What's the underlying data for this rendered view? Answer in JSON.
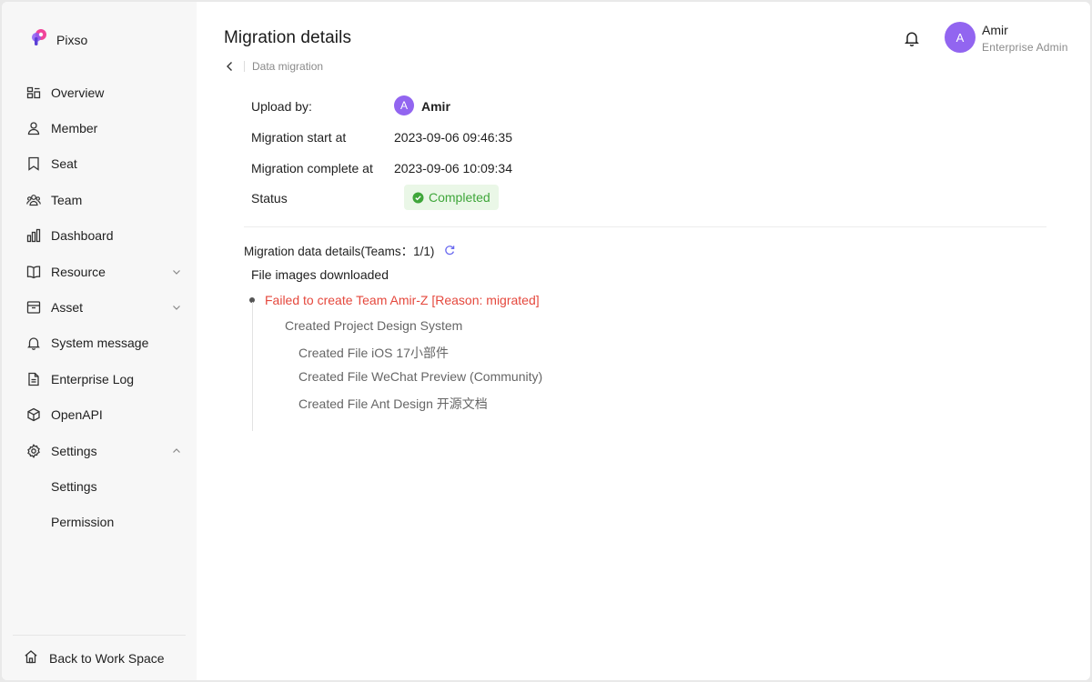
{
  "app": {
    "name": "Pixso"
  },
  "sidebar": {
    "items": [
      {
        "label": "Overview",
        "icon": "overview-icon"
      },
      {
        "label": "Member",
        "icon": "user-icon"
      },
      {
        "label": "Seat",
        "icon": "bookmark-icon"
      },
      {
        "label": "Team",
        "icon": "team-icon"
      },
      {
        "label": "Dashboard",
        "icon": "bar-chart-icon"
      },
      {
        "label": "Resource",
        "icon": "book-icon",
        "expandable": true,
        "expanded": false
      },
      {
        "label": "Asset",
        "icon": "archive-icon",
        "expandable": true,
        "expanded": false
      },
      {
        "label": "System message",
        "icon": "bell-icon"
      },
      {
        "label": "Enterprise Log",
        "icon": "file-icon"
      },
      {
        "label": "OpenAPI",
        "icon": "cube-icon"
      },
      {
        "label": "Settings",
        "icon": "gear-icon",
        "expandable": true,
        "expanded": true
      }
    ],
    "subitems": [
      {
        "label": "Settings"
      },
      {
        "label": "Permission"
      }
    ],
    "back_label": "Back to Work Space"
  },
  "header": {
    "title": "Migration details",
    "breadcrumb": "Data migration",
    "user": {
      "initial": "A",
      "name": "Amir",
      "role": "Enterprise Admin"
    }
  },
  "details": {
    "upload_by_label": "Upload by:",
    "uploader_initial": "A",
    "uploader_name": "Amir",
    "start_label": "Migration start at",
    "start_value": "2023-09-06 09:46:35",
    "complete_label": "Migration complete at",
    "complete_value": "2023-09-06 10:09:34",
    "status_label": "Status",
    "status_value": "Completed"
  },
  "migration": {
    "section_title": "Migration data details(Teams：1/1)",
    "root": "File images downloaded",
    "error": "Failed to create Team Amir-Z [Reason: migrated]",
    "project": "Created Project Design System",
    "files": [
      "Created File iOS 17小部件",
      "Created File WeChat Preview (Community)",
      "Created File Ant Design 开源文档"
    ]
  },
  "colors": {
    "accent": "#9265f0",
    "success": "#3fa63a",
    "success_bg": "#eaf7e7",
    "error": "#e5483d",
    "sidebar_bg": "#f7f7f7"
  }
}
